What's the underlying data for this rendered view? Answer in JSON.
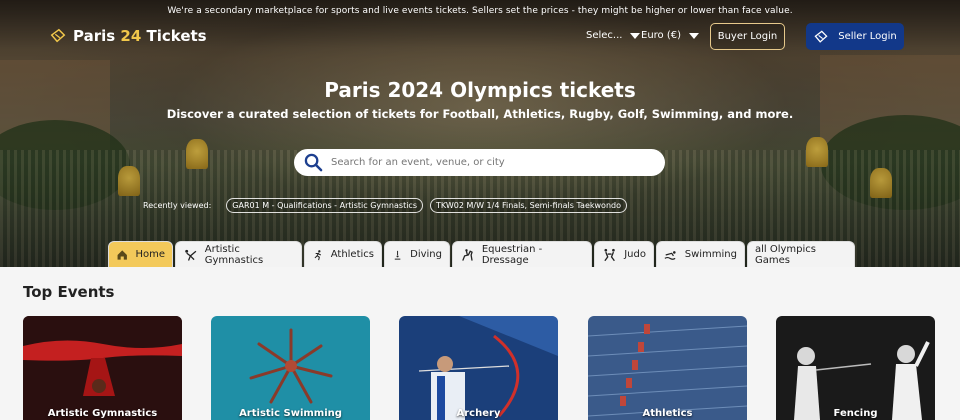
{
  "top_notice": "We're a secondary marketplace for sports and live events tickets. Sellers set the prices - they might be higher or lower than face value.",
  "brand": {
    "part1": "Paris ",
    "part2": "24",
    "part3": " Tickets"
  },
  "header": {
    "language_label": "Selec...",
    "currency_label": "Euro (€)",
    "buyer_login": "Buyer Login",
    "seller_login": "Seller Login"
  },
  "hero": {
    "title": "Paris 2024 Olympics tickets",
    "subtitle": "Discover a curated selection of tickets for Football, Athletics, Rugby, Golf, Swimming, and more."
  },
  "search": {
    "placeholder": "Search for an event, venue, or city"
  },
  "recently_viewed": {
    "label": "Recently viewed:",
    "items": [
      "GAR01 M - Qualifications - Artistic Gymnastics",
      "TKW02 M/W 1/4 Finals, Semi-finals Taekwondo"
    ]
  },
  "tabs": [
    {
      "label": "Home",
      "icon": "home-icon"
    },
    {
      "label": "Artistic Gymnastics",
      "icon": "gymnastics-icon"
    },
    {
      "label": "Athletics",
      "icon": "runner-icon"
    },
    {
      "label": "Diving",
      "icon": "diving-icon"
    },
    {
      "label": "Equestrian - Dressage",
      "icon": "horse-icon"
    },
    {
      "label": "Judo",
      "icon": "judo-icon"
    },
    {
      "label": "Swimming",
      "icon": "swimmer-icon"
    },
    {
      "label": "all Olympics Games",
      "icon": ""
    }
  ],
  "top_events": {
    "title": "Top Events",
    "cards": [
      {
        "label": "Artistic Gymnastics",
        "bg": "#2a0f0f"
      },
      {
        "label": "Artistic Swimming",
        "bg": "#1f8fa6"
      },
      {
        "label": "Archery",
        "bg": "#1b3f7a"
      },
      {
        "label": "Athletics",
        "bg": "#3a5a8a"
      },
      {
        "label": "Fencing",
        "bg": "#1a1a1a"
      }
    ]
  },
  "colors": {
    "accent_gold": "#f3c95a",
    "seller_blue": "#123889",
    "search_icon_blue": "#1d3f8f"
  }
}
